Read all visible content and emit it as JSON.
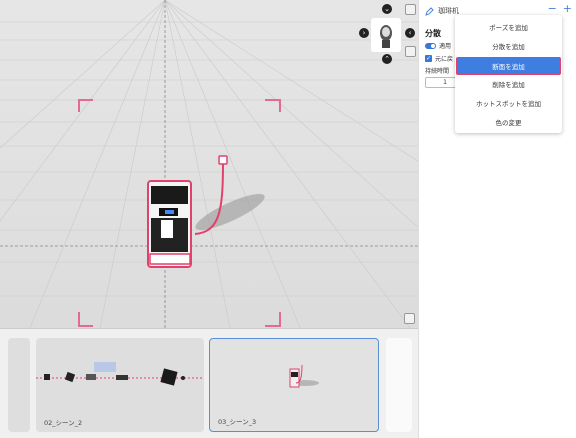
{
  "header": {
    "title": "珈琲机"
  },
  "properties": {
    "section_title": "分散",
    "apply_label": "適用",
    "restore_label": "元に戻",
    "duration_label": "持続時間",
    "duration_value": "1"
  },
  "dropdown": {
    "items": [
      {
        "label": "ポーズを追加"
      },
      {
        "label": "分散を追加"
      },
      {
        "label": "断面を追加"
      },
      {
        "label": "削除を追加"
      },
      {
        "label": "ホットスポットを追加"
      },
      {
        "label": "色の変更"
      }
    ],
    "selected_index": 2
  },
  "timeline": {
    "scenes": [
      {
        "label": "02_シーン_2"
      },
      {
        "label": "03_シーン_3"
      }
    ]
  },
  "colors": {
    "accent": "#3d7ee0",
    "highlight": "#e0426d",
    "selection_border": "#5a8fd8"
  }
}
